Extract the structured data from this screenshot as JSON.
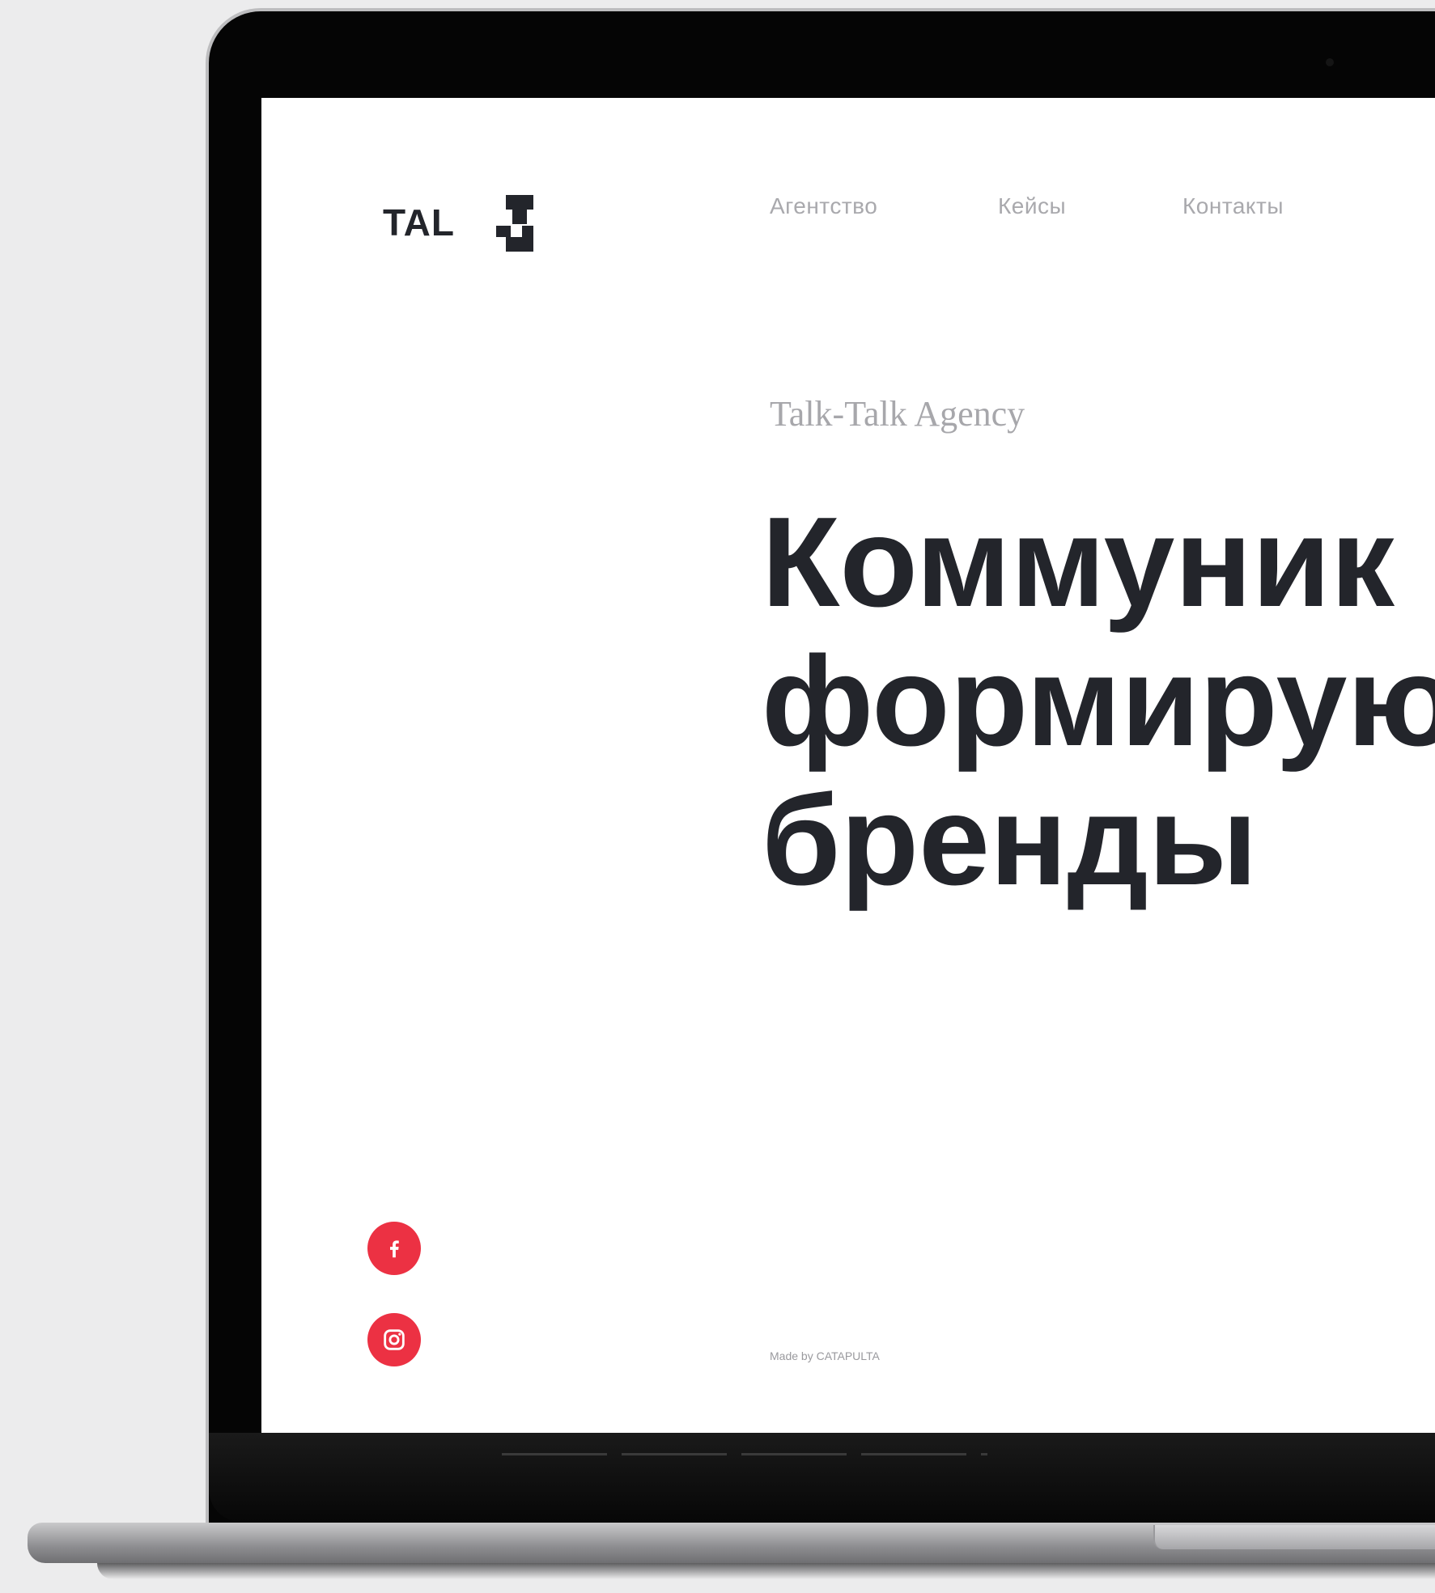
{
  "nav": {
    "items": [
      {
        "label": "Агентство"
      },
      {
        "label": "Кейсы"
      },
      {
        "label": "Контакты"
      }
    ]
  },
  "logo": {
    "text": "TAL"
  },
  "hero": {
    "eyebrow": "Talk-Talk Agency",
    "headline_lines": [
      "Коммуник",
      "формирую",
      "бренды"
    ]
  },
  "social": [
    {
      "icon": "facebook-icon"
    },
    {
      "icon": "instagram-icon"
    }
  ],
  "footer": {
    "credit": "Made by CATAPULTA"
  },
  "colors": {
    "accent": "#ec3143",
    "heading": "#23252b",
    "muted": "#a9a9ad",
    "background": "#ececed"
  }
}
